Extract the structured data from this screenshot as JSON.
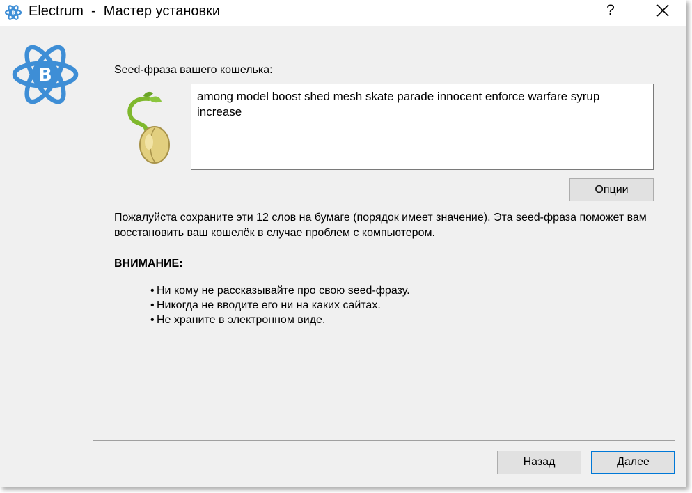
{
  "window": {
    "title": "Electrum  -  Мастер установки",
    "help_glyph": "?",
    "close_icon": "close-icon",
    "app_icon": "electrum-atom-bitcoin-icon"
  },
  "seed": {
    "label": "Seed-фраза вашего кошелька:",
    "phrase": "among model boost shed mesh skate parade innocent enforce warfare syrup increase",
    "image_icon": "sprouting-seed-icon"
  },
  "buttons": {
    "options": "Опции",
    "back": "Назад",
    "next": "Далее"
  },
  "info": {
    "text": "Пожалуйста сохраните эти 12 слов на бумаге (порядок имеет значение). Эта seed-фраза поможет вам восстановить ваш кошелёк в случае проблем с компьютером."
  },
  "warning": {
    "title": "ВНИМАНИЕ:",
    "bullet": "•",
    "items": [
      "Ни кому не рассказывайте про свою seed-фразу.",
      "Никогда не вводите его ни на каких сайтах.",
      "Не храните в электронном виде."
    ]
  },
  "colors": {
    "electrum_blue": "#3e8ed6",
    "focus_blue": "#0078d7"
  }
}
